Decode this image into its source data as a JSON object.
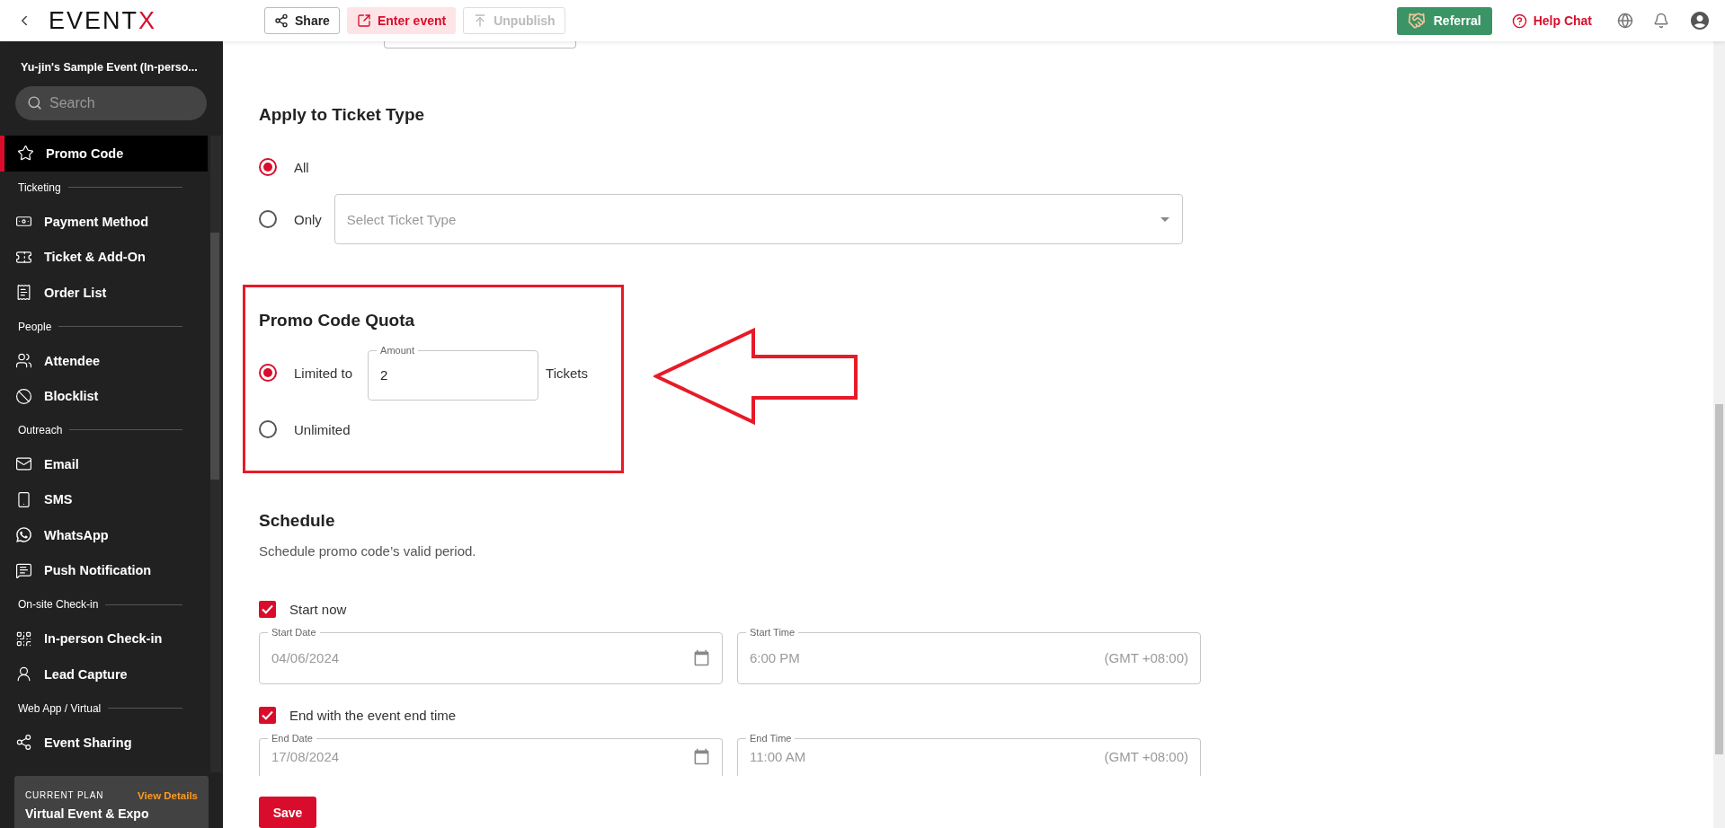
{
  "topbar": {
    "logo": {
      "text": "EVENT",
      "accent": "X"
    },
    "actions": [
      {
        "label": "Share",
        "kind": "outline",
        "disabled": false
      },
      {
        "label": "Enter event",
        "kind": "tinted",
        "disabled": false
      },
      {
        "label": "Unpublish",
        "kind": "outline",
        "disabled": true
      }
    ],
    "referral": "Referral",
    "help": "Help Chat"
  },
  "sidebar": {
    "event_title": "Yu-jin's Sample Event (In-perso...",
    "search": {
      "placeholder": "Search"
    },
    "items": [
      {
        "kind": "item",
        "label": "Promo Code",
        "selected": true
      },
      {
        "kind": "section",
        "label": "Ticketing"
      },
      {
        "kind": "item",
        "label": "Payment Method",
        "selected": false
      },
      {
        "kind": "item",
        "label": "Ticket & Add-On",
        "selected": false
      },
      {
        "kind": "item",
        "label": "Order List",
        "selected": false
      },
      {
        "kind": "section",
        "label": "People"
      },
      {
        "kind": "item",
        "label": "Attendee",
        "selected": false
      },
      {
        "kind": "item",
        "label": "Blocklist",
        "selected": false
      },
      {
        "kind": "section",
        "label": "Outreach"
      },
      {
        "kind": "item",
        "label": "Email",
        "selected": false
      },
      {
        "kind": "item",
        "label": "SMS",
        "selected": false
      },
      {
        "kind": "item",
        "label": "WhatsApp",
        "selected": false
      },
      {
        "kind": "item",
        "label": "Push Notification",
        "selected": false
      },
      {
        "kind": "section",
        "label": "On-site Check-in"
      },
      {
        "kind": "item",
        "label": "In-person Check-in",
        "selected": false
      },
      {
        "kind": "item",
        "label": "Lead Capture",
        "selected": false
      },
      {
        "kind": "section",
        "label": "Web App / Virtual"
      },
      {
        "kind": "item",
        "label": "Event Sharing",
        "selected": false
      }
    ],
    "plan": {
      "caption": "CURRENT PLAN",
      "link": "View Details",
      "name": "Virtual Event & Expo"
    }
  },
  "ticket_type": {
    "heading": "Apply to Ticket Type",
    "options": [
      {
        "label": "All",
        "selected": true,
        "kind": "plain"
      },
      {
        "label": "Only",
        "selected": false,
        "kind": "select"
      }
    ],
    "select": {
      "placeholder": "Select Ticket Type"
    }
  },
  "quota": {
    "heading": "Promo Code Quota",
    "options": [
      {
        "label": "Limited to",
        "selected": true,
        "kind": "amount"
      },
      {
        "label": "Unlimited",
        "selected": false,
        "kind": "plain"
      }
    ],
    "amount": {
      "label": "Amount",
      "value": "2",
      "unit": "Tickets"
    }
  },
  "schedule": {
    "heading": "Schedule",
    "description": "Schedule promo code’s valid period.",
    "rows": [
      {
        "checkbox": "Start now",
        "checked": true,
        "date_label": "Start Date",
        "date": "04/06/2024",
        "time_label": "Start Time",
        "time": "6:00 PM",
        "timezone": "(GMT +08:00)"
      },
      {
        "checkbox": "End with the event end time",
        "checked": true,
        "date_label": "End Date",
        "date": "17/08/2024",
        "time_label": "End Time",
        "time": "11:00 AM",
        "timezone": "(GMT +08:00)"
      }
    ]
  },
  "save": "Save"
}
